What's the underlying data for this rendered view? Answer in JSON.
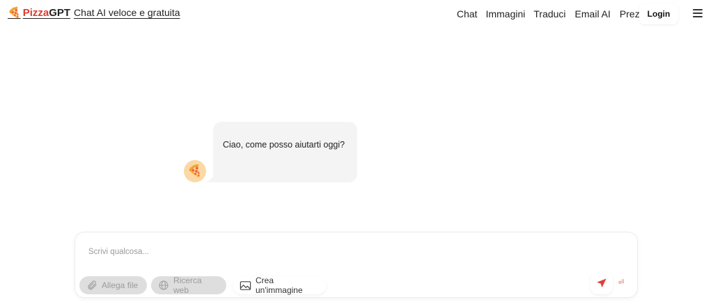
{
  "header": {
    "brand_pizza": "Pizza",
    "brand_gpt": "GPT",
    "tagline": "Chat AI veloce e gratuita",
    "nav": [
      "Chat",
      "Immagini",
      "Traduci",
      "Email AI",
      "Prezzi"
    ],
    "login_label": "Login"
  },
  "chat": {
    "greeting": "Ciao, come posso aiutarti oggi?"
  },
  "composer": {
    "placeholder": "Scrivi qualcosa...",
    "attach_label": "Allega file",
    "web_label": "Ricerca web",
    "image_label": "Crea un'immagine"
  },
  "colors": {
    "brand_red": "#e03a2e",
    "send_red": "#e0403a",
    "avatar_bg": "#fbd9a6",
    "bubble_bg": "#f4f4f4"
  }
}
